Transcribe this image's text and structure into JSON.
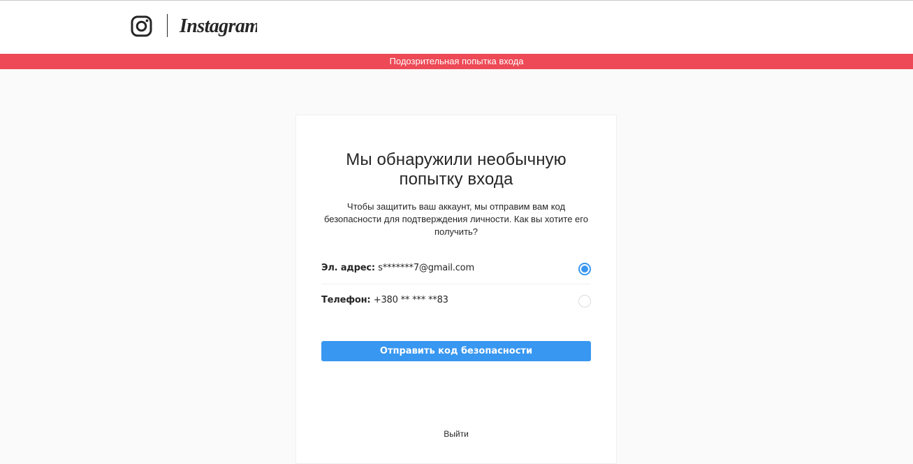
{
  "header": {
    "logo_icon": "instagram-camera-icon",
    "wordmark": "Instagram"
  },
  "alert": {
    "text": "Подозрительная попытка входа",
    "color": "#ed4956"
  },
  "card": {
    "title_line1": "Мы обнаружили необычную",
    "title_line2": "попытку входа",
    "description": "Чтобы защитить ваш аккаунт, мы отправим вам код безопасности для подтверждения личности. Как вы хотите его получить?",
    "options": [
      {
        "label": "Эл. адрес:",
        "value": "s*******7@gmail.com",
        "selected": true
      },
      {
        "label": "Телефон:",
        "value": "+380 ** *** **83",
        "selected": false
      }
    ],
    "send_button": "Отправить код безопасности",
    "logout": "Выйти"
  },
  "colors": {
    "accent": "#3897f0",
    "text": "#262626",
    "background": "#fafafa"
  }
}
